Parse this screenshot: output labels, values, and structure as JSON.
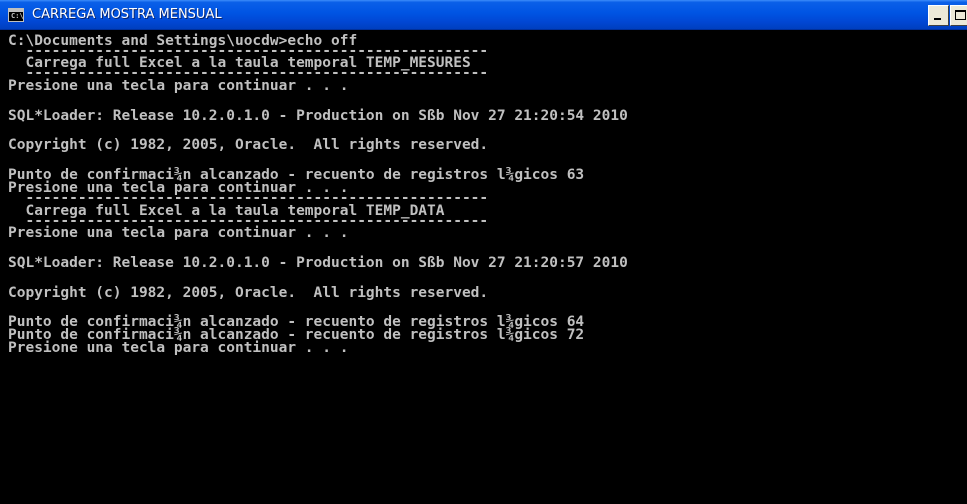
{
  "window": {
    "title": "CARREGA MOSTRA MENSUAL",
    "app_icon": "console-icon",
    "app_icon_glyph": "C:\\",
    "controls": [
      "minimize-icon",
      "maximize-icon"
    ]
  },
  "console": {
    "text_color": "#c0c0c0",
    "background": "#000000",
    "lines": [
      "C:\\Documents and Settings\\uocdw>echo off",
      "  -----------------------------------------------------",
      "  Carrega full Excel a la taula temporal TEMP_MESURES",
      "  -----------------------------------------------------",
      "Presione una tecla para continuar . . .",
      "SQL*Loader: Release 10.2.0.1.0 - Production on Sßb Nov 27 21:20:54 2010",
      "Copyright (c) 1982, 2005, Oracle.  All rights reserved.",
      "Punto de confirmaci¾n alcanzado - recuento de registros l¾gicos 63",
      "Presione una tecla para continuar . . .",
      "  -----------------------------------------------------",
      "  Carrega full Excel a la taula temporal TEMP_DATA",
      "  -----------------------------------------------------",
      "Presione una tecla para continuar . . .",
      "SQL*Loader: Release 10.2.0.1.0 - Production on Sßb Nov 27 21:20:57 2010",
      "Copyright (c) 1982, 2005, Oracle.  All rights reserved.",
      "Punto de confirmaci¾n alcanzado - recuento de registros l¾gicos 64",
      "Punto de confirmaci¾n alcanzado - recuento de registros l¾gicos 72",
      "Presione una tecla para continuar . . ."
    ]
  }
}
